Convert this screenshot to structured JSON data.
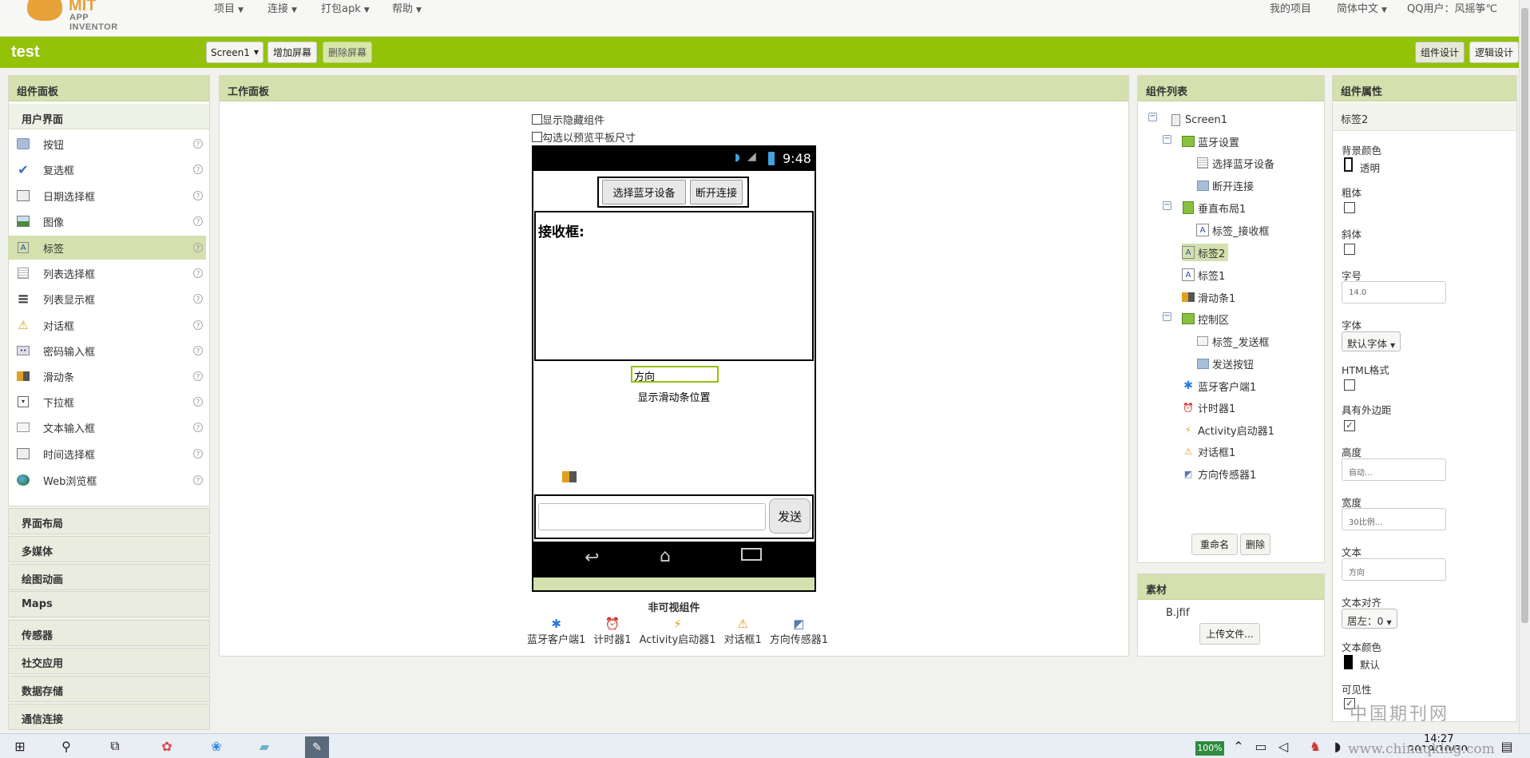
{
  "app": {
    "logo_mit": "MIT",
    "logo_sub": "APP INVENTOR",
    "project_name": "test"
  },
  "topnav": {
    "menus": [
      "项目",
      "连接",
      "打包apk",
      "帮助"
    ],
    "my_projects": "我的项目",
    "language": "简体中文",
    "user": "QQ用户：风摇筝℃"
  },
  "toolbar": {
    "screen_select": "Screen1",
    "add_screen": "增加屏幕",
    "remove_screen": "删除屏幕",
    "designer": "组件设计",
    "blocks": "逻辑设计"
  },
  "palette": {
    "title": "组件面板",
    "category_open": "用户界面",
    "items": [
      "按钮",
      "复选框",
      "日期选择框",
      "图像",
      "标签",
      "列表选择框",
      "列表显示框",
      "对话框",
      "密码输入框",
      "滑动条",
      "下拉框",
      "文本输入框",
      "时间选择框",
      "Web浏览框"
    ],
    "help_glyph": "?",
    "categories": [
      "界面布局",
      "多媒体",
      "绘图动画",
      "Maps",
      "传感器",
      "社交应用",
      "数据存储",
      "通信连接"
    ]
  },
  "viewer": {
    "title": "工作面板",
    "show_hidden": "显示隐藏组件",
    "tablet_preview": "勾选以预览平板尺寸",
    "status_time": "9:48",
    "btn_select_bt": "选择蓝牙设备",
    "btn_disconnect": "断开连接",
    "receive_label": "接收框:",
    "direction_value": "方向",
    "slider_pos_label": "显示滑动条位置",
    "send_button": "发送",
    "nonvisible_title": "非可视组件",
    "nonvisible": [
      "蓝牙客户端1",
      "计时器1",
      "Activity启动器1",
      "对话框1",
      "方向传感器1"
    ]
  },
  "tree": {
    "title": "组件列表",
    "nodes": [
      "Screen1",
      "蓝牙设置",
      "选择蓝牙设备",
      "断开连接",
      "垂直布局1",
      "标签_接收框",
      "标签2",
      "标签1",
      "滑动条1",
      "控制区",
      "标签_发送框",
      "发送按钮",
      "蓝牙客户端1",
      "计时器1",
      "Activity启动器1",
      "对话框1",
      "方向传感器1"
    ],
    "rename": "重命名",
    "delete": "删除",
    "toggle_glyph": "−"
  },
  "media": {
    "title": "素材",
    "file": "B.jfif",
    "upload": "上传文件..."
  },
  "props": {
    "title": "组件属性",
    "component": "标签2",
    "bg_color_label": "背景颜色",
    "bg_color_value": "透明",
    "bold_label": "粗体",
    "italic_label": "斜体",
    "fontsize_label": "字号",
    "fontsize_value": "14.0",
    "font_label": "字体",
    "font_value": "默认字体",
    "html_label": "HTML格式",
    "margin_label": "具有外边距",
    "height_label": "高度",
    "height_value": "自动...",
    "width_label": "宽度",
    "width_value": "30比例...",
    "text_label": "文本",
    "text_value": "方向",
    "align_label": "文本对齐",
    "align_value": "居左：0",
    "textcolor_label": "文本颜色",
    "textcolor_value": "默认",
    "visible_label": "可见性"
  },
  "watermark": "中国期刊网",
  "taskbar": {
    "battery": "100%",
    "time": "14:27",
    "date": "2019/10/30",
    "url_fragment": "www.chinaqking.com"
  },
  "colors": {
    "green": "#93c209",
    "panel_head": "#d4e0ad"
  }
}
